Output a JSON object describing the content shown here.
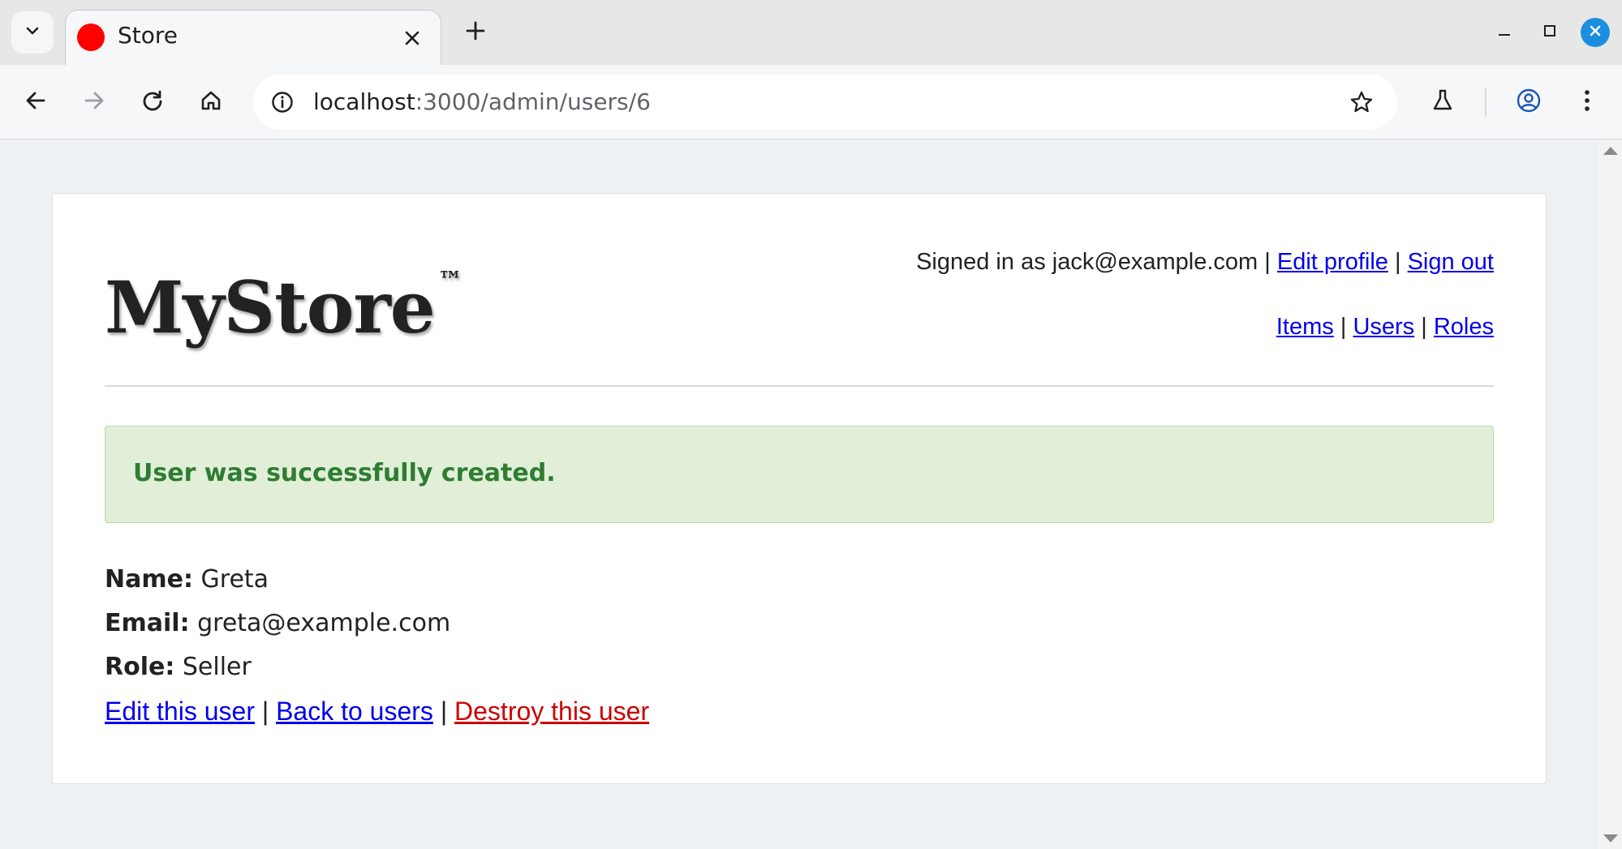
{
  "browser": {
    "tab_title": "Store",
    "url_host": "localhost",
    "url_rest": ":3000/admin/users/6"
  },
  "header": {
    "logo_text": "MyStore",
    "logo_mark": "™",
    "signed_in_text": "Signed in as jack@example.com",
    "edit_profile_label": "Edit profile",
    "sign_out_label": "Sign out",
    "nav": {
      "items_label": "Items",
      "users_label": "Users",
      "roles_label": "Roles"
    },
    "separator": "|"
  },
  "flash": {
    "message": "User was successfully created."
  },
  "user": {
    "name_label": "Name:",
    "name_value": "Greta",
    "email_label": "Email:",
    "email_value": "greta@example.com",
    "role_label": "Role:",
    "role_value": "Seller"
  },
  "actions": {
    "edit_label": "Edit this user",
    "back_label": "Back to users",
    "destroy_label": "Destroy this user"
  },
  "colors": {
    "link": "#0000ee",
    "danger_link": "#cc0000",
    "flash_bg": "#e1efd9",
    "flash_text": "#2e7d32",
    "favicon": "#ff0000"
  }
}
